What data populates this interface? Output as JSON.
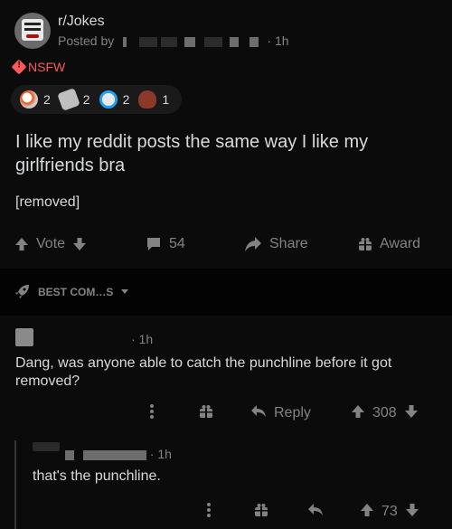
{
  "post": {
    "subreddit": "r/Jokes",
    "posted_by_label": "Posted by",
    "time": "· 1h",
    "nsfw_label": "NSFW",
    "awards": [
      {
        "icon": "silver-award-icon",
        "count": "2"
      },
      {
        "icon": "hands-award-icon",
        "count": "2"
      },
      {
        "icon": "s-award-icon",
        "count": "2"
      },
      {
        "icon": "poop-award-icon",
        "count": "1"
      }
    ],
    "title": "I like my reddit posts the same way I like my girlfriends bra",
    "body": "[removed]",
    "actions": {
      "vote_label": "Vote",
      "comments_count": "54",
      "share_label": "Share",
      "award_label": "Award"
    }
  },
  "sort": {
    "label": "BEST COM…S"
  },
  "comments": [
    {
      "time": "· 1h",
      "text": "Dang, was anyone able to catch the punchline before it got removed?",
      "reply_label": "Reply",
      "score": "308"
    },
    {
      "time": "· 1h",
      "text": "that's the punchline.",
      "score": "73"
    }
  ],
  "colors": {
    "background": "#030303",
    "card": "#0b0b0b",
    "text": "#d7dadc",
    "muted": "#818384",
    "nsfw": "#ff585b"
  }
}
